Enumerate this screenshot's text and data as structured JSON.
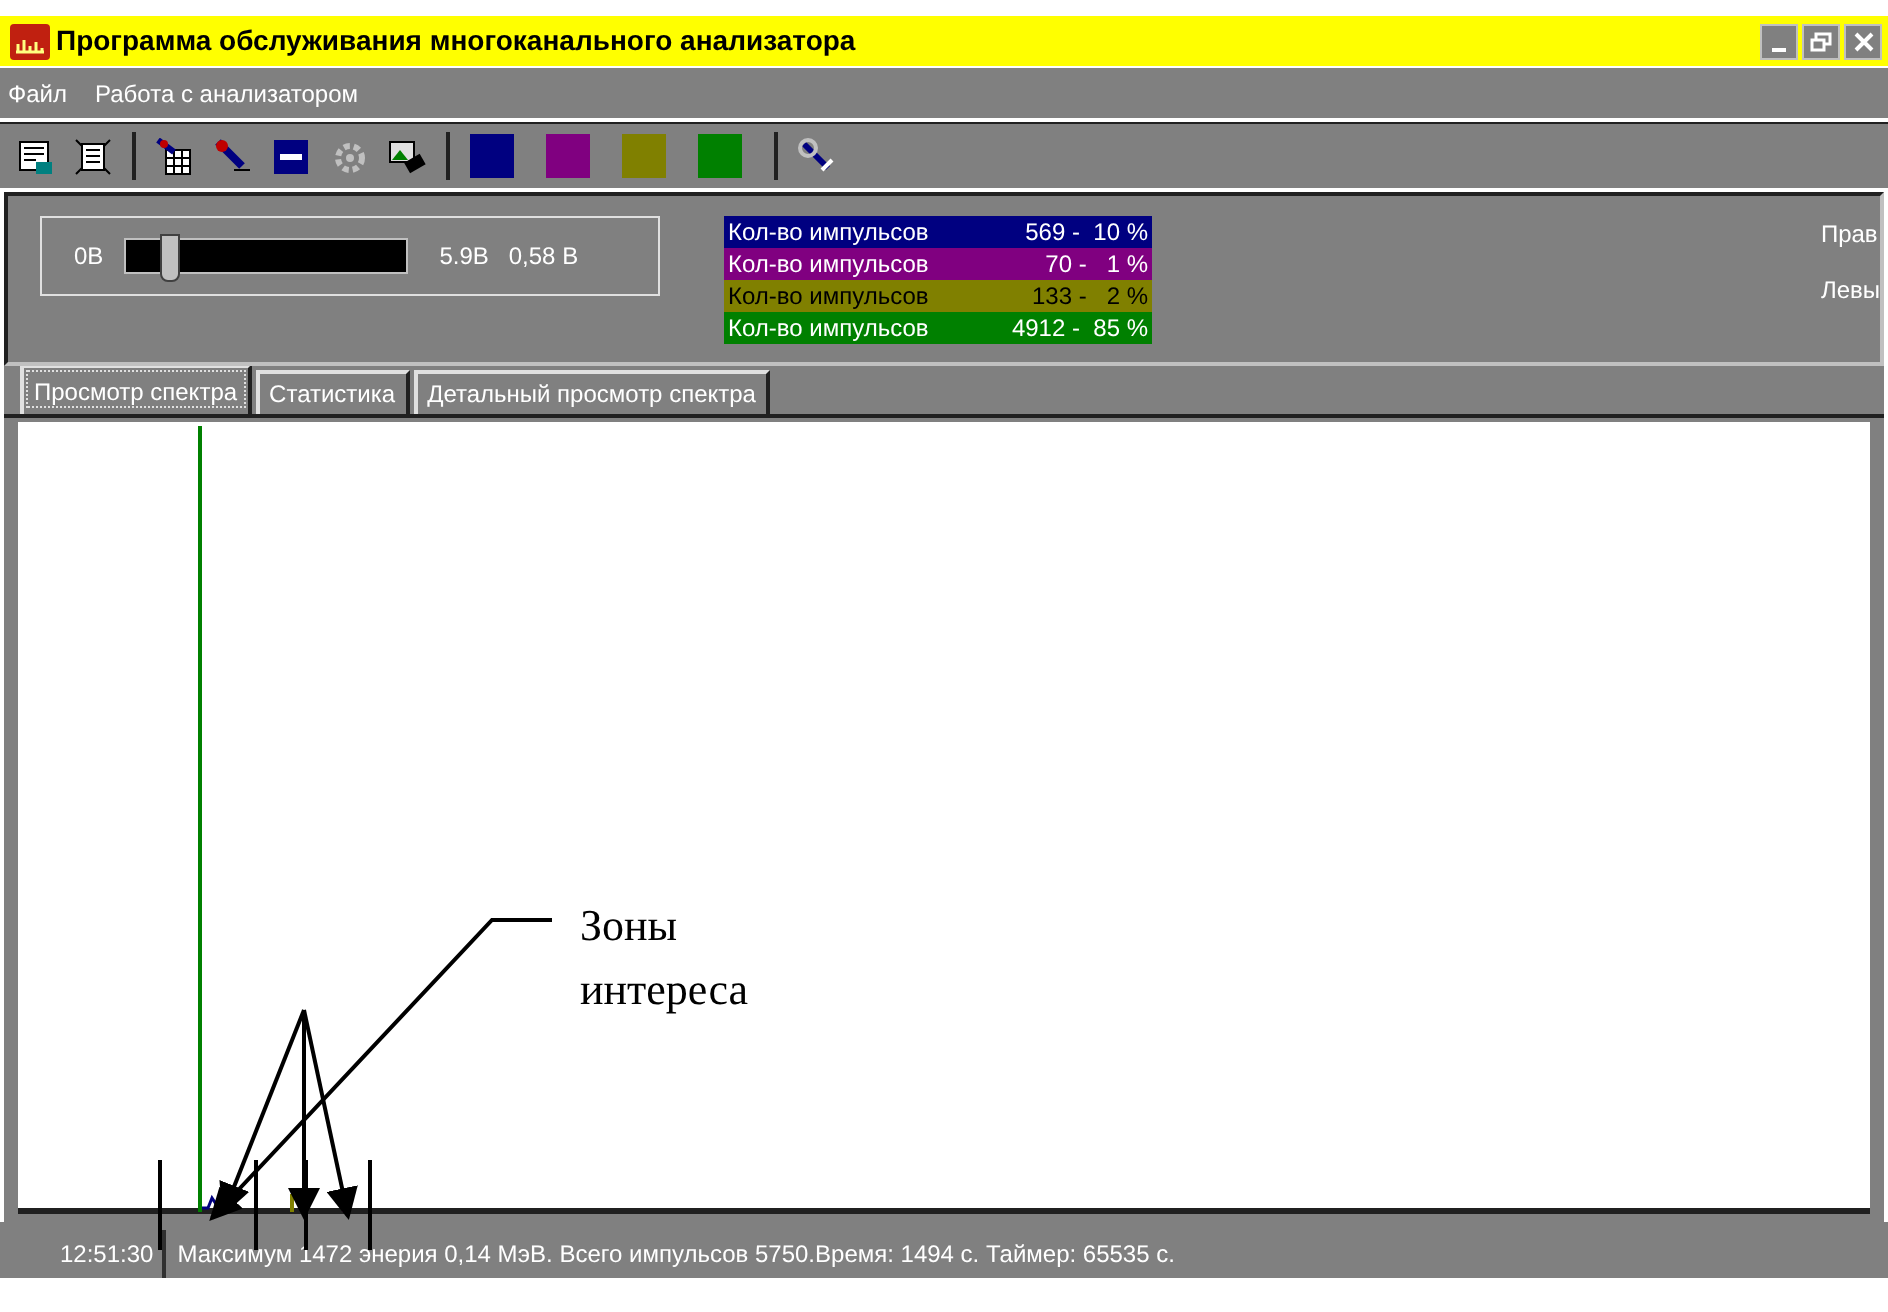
{
  "window": {
    "title": "Программа обслуживания многоканального анализатора"
  },
  "menu": [
    "Файл",
    "Работа с анализатором"
  ],
  "toolbar": {
    "color_buttons": [
      {
        "color": "#000080"
      },
      {
        "color": "#800080"
      },
      {
        "color": "#808000"
      },
      {
        "color": "#008000"
      }
    ]
  },
  "threshold": {
    "min_label": "0В",
    "level": 0.13,
    "max_label": "5.9В",
    "reading": "0,58 В"
  },
  "counters": [
    {
      "label": "Кол-во импульсов",
      "value": "569 -  10 %",
      "color": "#000080"
    },
    {
      "label": "Кол-во импульсов",
      "value": "70 -   1 %",
      "color": "#800080"
    },
    {
      "label": "Кол-во импульсов",
      "value": "133 -   2 %",
      "color": "#808000"
    },
    {
      "label": "Кол-во импульсов",
      "value": "4912 -  85 %",
      "color": "#008000"
    }
  ],
  "side_labels": [
    "Прав",
    "Левы"
  ],
  "tabs": [
    {
      "label": "Просмотр спектра",
      "selected": true
    },
    {
      "label": "Статистика",
      "selected": false
    },
    {
      "label": "Детальный просмотр спектра",
      "selected": false
    }
  ],
  "annotation": {
    "lines": [
      "Зоны",
      "интереса"
    ]
  },
  "status_bar": {
    "time": "12:51:30",
    "message": "Максимум  1472 энерия 0,14 МэВ. Всего импульсов   5750.Время:  1494 с. Таймер: 65535 с."
  }
}
